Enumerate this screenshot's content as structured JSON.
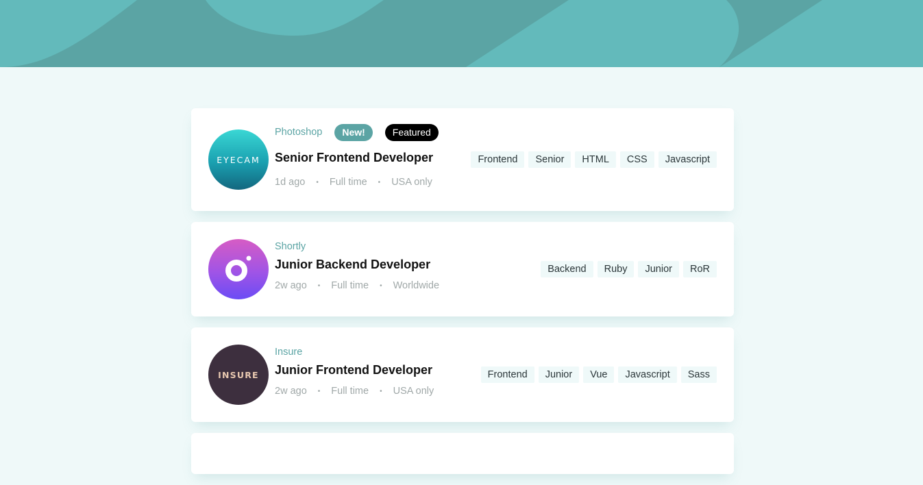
{
  "colors": {
    "accent": "#5ba4a4",
    "background": "#eff9f9",
    "featured": "#000000"
  },
  "jobs": [
    {
      "logo_text": "EYECAM",
      "company": "Photoshop",
      "badge_new": "New!",
      "badge_featured": "Featured",
      "title": "Senior Frontend Developer",
      "posted": "1d ago",
      "contract": "Full time",
      "location": "USA only",
      "tags": [
        "Frontend",
        "Senior",
        "HTML",
        "CSS",
        "Javascript"
      ]
    },
    {
      "logo_icon": "ring-logo-icon",
      "company": "Shortly",
      "title": "Junior Backend Developer",
      "posted": "2w ago",
      "contract": "Full time",
      "location": "Worldwide",
      "tags": [
        "Backend",
        "Ruby",
        "Junior",
        "RoR"
      ]
    },
    {
      "logo_text": "INSURE",
      "company": "Insure",
      "title": "Junior Frontend Developer",
      "posted": "2w ago",
      "contract": "Full time",
      "location": "USA only",
      "tags": [
        "Frontend",
        "Junior",
        "Vue",
        "Javascript",
        "Sass"
      ]
    }
  ],
  "separator": "•"
}
